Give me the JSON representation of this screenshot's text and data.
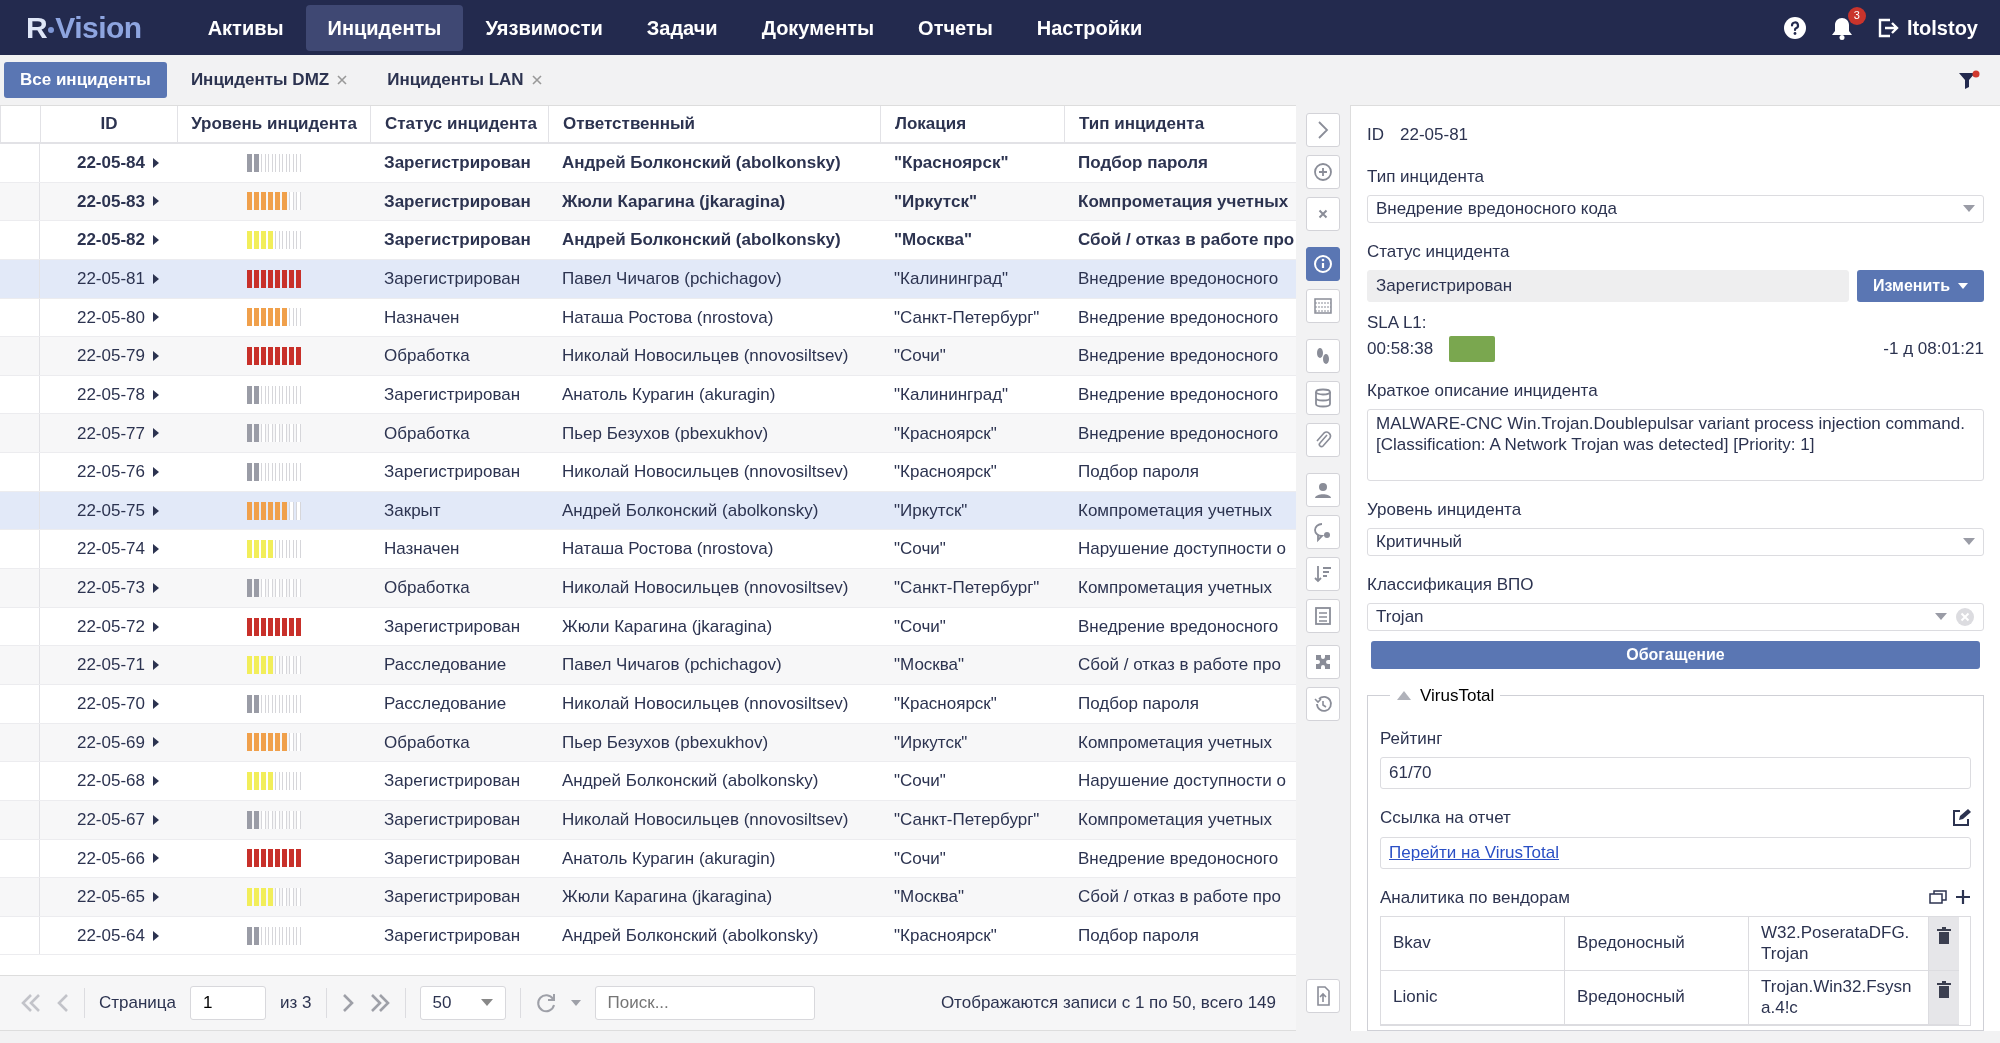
{
  "header": {
    "logo_r": "R",
    "logo_rest": "Vision",
    "nav": [
      {
        "label": "Активы",
        "selected": false
      },
      {
        "label": "Инциденты",
        "selected": true
      },
      {
        "label": "Уязвимости",
        "selected": false
      },
      {
        "label": "Задачи",
        "selected": false
      },
      {
        "label": "Документы",
        "selected": false
      },
      {
        "label": "Отчеты",
        "selected": false
      },
      {
        "label": "Настройки",
        "selected": false
      }
    ],
    "notifications": "3",
    "user": "ltolstoy"
  },
  "filter_tabs": [
    {
      "label": "Все инциденты",
      "selected": true,
      "closable": false
    },
    {
      "label": "Инциденты DMZ",
      "selected": false,
      "closable": true
    },
    {
      "label": "Инциденты LAN",
      "selected": false,
      "closable": true
    }
  ],
  "table": {
    "columns": [
      "ID",
      "Уровень инцидента",
      "Статус инцидента",
      "Ответственный",
      "Локация",
      "Тип инцидента"
    ],
    "rows": [
      {
        "id": "22-05-84",
        "level": 0.25,
        "color": "#9a9ca6",
        "status": "Зарегистрирован",
        "owner": "Андрей Болконский (abolkonsky)",
        "location": "\"Красноярск\"",
        "type": "Подбор пароля",
        "unread": true,
        "selected": false
      },
      {
        "id": "22-05-83",
        "level": 0.75,
        "color": "#f0a04b",
        "status": "Зарегистрирован",
        "owner": "Жюли Карагина (jkaragina)",
        "location": "\"Иркутск\"",
        "type": "Компрометация учетных",
        "unread": true,
        "selected": false
      },
      {
        "id": "22-05-82",
        "level": 0.5,
        "color": "#f2ee5a",
        "status": "Зарегистрирован",
        "owner": "Андрей Болконский (abolkonsky)",
        "location": "\"Москва\"",
        "type": "Сбой / отказ в работе про",
        "unread": true,
        "selected": false
      },
      {
        "id": "22-05-81",
        "level": 1,
        "color": "#c8302a",
        "status": "Зарегистрирован",
        "owner": "Павел Чичагов (pchichagov)",
        "location": "\"Калининград\"",
        "type": "Внедрение вредоносного",
        "unread": false,
        "selected": true
      },
      {
        "id": "22-05-80",
        "level": 0.75,
        "color": "#f0a04b",
        "status": "Назначен",
        "owner": "Наташа Ростова (nrostova)",
        "location": "\"Санкт-Петербург\"",
        "type": "Внедрение вредоносного",
        "unread": false,
        "selected": false
      },
      {
        "id": "22-05-79",
        "level": 1,
        "color": "#c8302a",
        "status": "Обработка",
        "owner": "Николай Новосильцев (nnovosiltsev)",
        "location": "\"Сочи\"",
        "type": "Внедрение вредоносного",
        "unread": false,
        "selected": false
      },
      {
        "id": "22-05-78",
        "level": 0.25,
        "color": "#9a9ca6",
        "status": "Зарегистрирован",
        "owner": "Анатоль Курагин (akuragin)",
        "location": "\"Калининград\"",
        "type": "Внедрение вредоносного",
        "unread": false,
        "selected": false
      },
      {
        "id": "22-05-77",
        "level": 0.25,
        "color": "#9a9ca6",
        "status": "Обработка",
        "owner": "Пьер Безухов (pbexukhov)",
        "location": "\"Красноярск\"",
        "type": "Внедрение вредоносного",
        "unread": false,
        "selected": false
      },
      {
        "id": "22-05-76",
        "level": 0.25,
        "color": "#9a9ca6",
        "status": "Зарегистрирован",
        "owner": "Николай Новосильцев (nnovosiltsev)",
        "location": "\"Красноярск\"",
        "type": "Подбор пароля",
        "unread": false,
        "selected": false
      },
      {
        "id": "22-05-75",
        "level": 0.75,
        "color": "#f0a04b",
        "status": "Закрыт",
        "owner": "Андрей Болконский (abolkonsky)",
        "location": "\"Иркутск\"",
        "type": "Компрометация учетных",
        "unread": false,
        "selected": true
      },
      {
        "id": "22-05-74",
        "level": 0.5,
        "color": "#f2ee5a",
        "status": "Назначен",
        "owner": "Наташа Ростова (nrostova)",
        "location": "\"Сочи\"",
        "type": "Нарушение доступности о",
        "unread": false,
        "selected": false
      },
      {
        "id": "22-05-73",
        "level": 0.25,
        "color": "#9a9ca6",
        "status": "Обработка",
        "owner": "Николай Новосильцев (nnovosiltsev)",
        "location": "\"Санкт-Петербург\"",
        "type": "Компрометация учетных",
        "unread": false,
        "selected": false
      },
      {
        "id": "22-05-72",
        "level": 1,
        "color": "#c8302a",
        "status": "Зарегистрирован",
        "owner": "Жюли Карагина (jkaragina)",
        "location": "\"Сочи\"",
        "type": "Внедрение вредоносного",
        "unread": false,
        "selected": false
      },
      {
        "id": "22-05-71",
        "level": 0.5,
        "color": "#f2ee5a",
        "status": "Расследование",
        "owner": "Павел Чичагов (pchichagov)",
        "location": "\"Москва\"",
        "type": "Сбой / отказ в работе про",
        "unread": false,
        "selected": false
      },
      {
        "id": "22-05-70",
        "level": 0.25,
        "color": "#9a9ca6",
        "status": "Расследование",
        "owner": "Николай Новосильцев (nnovosiltsev)",
        "location": "\"Красноярск\"",
        "type": "Подбор пароля",
        "unread": false,
        "selected": false
      },
      {
        "id": "22-05-69",
        "level": 0.75,
        "color": "#f0a04b",
        "status": "Обработка",
        "owner": "Пьер Безухов (pbexukhov)",
        "location": "\"Иркутск\"",
        "type": "Компрометация учетных",
        "unread": false,
        "selected": false
      },
      {
        "id": "22-05-68",
        "level": 0.5,
        "color": "#f2ee5a",
        "status": "Зарегистрирован",
        "owner": "Андрей Болконский (abolkonsky)",
        "location": "\"Сочи\"",
        "type": "Нарушение доступности о",
        "unread": false,
        "selected": false
      },
      {
        "id": "22-05-67",
        "level": 0.25,
        "color": "#9a9ca6",
        "status": "Зарегистрирован",
        "owner": "Николай Новосильцев (nnovosiltsev)",
        "location": "\"Санкт-Петербург\"",
        "type": "Компрометация учетных",
        "unread": false,
        "selected": false
      },
      {
        "id": "22-05-66",
        "level": 1,
        "color": "#c8302a",
        "status": "Зарегистрирован",
        "owner": "Анатоль Курагин (akuragin)",
        "location": "\"Сочи\"",
        "type": "Внедрение вредоносного",
        "unread": false,
        "selected": false
      },
      {
        "id": "22-05-65",
        "level": 0.5,
        "color": "#f2ee5a",
        "status": "Зарегистрирован",
        "owner": "Жюли Карагина (jkaragina)",
        "location": "\"Москва\"",
        "type": "Сбой / отказ в работе про",
        "unread": false,
        "selected": false
      },
      {
        "id": "22-05-64",
        "level": 0.25,
        "color": "#9a9ca6",
        "status": "Зарегистрирован",
        "owner": "Андрей Болконский (abolkonsky)",
        "location": "\"Красноярск\"",
        "type": "Подбор пароля",
        "unread": false,
        "selected": false
      }
    ]
  },
  "pager": {
    "page_label": "Страница",
    "page": "1",
    "of": "из 3",
    "page_size": "50",
    "search_placeholder": "Поиск...",
    "summary": "Отображаются записи с 1 по 50, всего 149"
  },
  "side_toolbar": [
    {
      "kind": "collapse",
      "selected": false
    },
    {
      "kind": "add",
      "selected": false
    },
    {
      "kind": "close",
      "selected": false
    },
    {
      "kind": "info",
      "selected": true
    },
    {
      "kind": "grid",
      "selected": false
    },
    {
      "kind": "steps",
      "selected": false
    },
    {
      "kind": "database",
      "selected": false
    },
    {
      "kind": "attach",
      "selected": false
    },
    {
      "kind": "user",
      "selected": false
    },
    {
      "kind": "comment",
      "selected": false
    },
    {
      "kind": "sort",
      "selected": false
    },
    {
      "kind": "list",
      "selected": false
    },
    {
      "kind": "puzzle",
      "selected": false
    },
    {
      "kind": "history",
      "selected": false
    },
    {
      "kind": "export",
      "selected": false
    }
  ],
  "details": {
    "id_label": "ID",
    "id": "22-05-81",
    "type_label": "Тип инцидента",
    "type": "Внедрение вредоносного кода",
    "status_label": "Статус инцидента",
    "status": "Зарегистрирован",
    "change_button": "Изменить",
    "sla_label": "SLA L1:",
    "sla_time": "00:58:38",
    "sla_remaining": "-1 д 08:01:21",
    "description_label": "Краткое описание инцидента",
    "description": "MALWARE-CNC Win.Trojan.Doublepulsar variant process injection command. [Classification: A Network Trojan was detected] [Priority: 1]",
    "level_label": "Уровень инцидента",
    "level": "Критичный",
    "malware_label": "Классификация ВПО",
    "malware": "Trojan",
    "enrich_button": "Обогащение",
    "virustotal": {
      "title": "VirusTotal",
      "expanded": true,
      "rating_label": "Рейтинг",
      "rating": "61/70",
      "link_label": "Ссылка на отчет",
      "link": "Перейти на VirusTotal",
      "vendors_label": "Аналитика по вендорам",
      "vendors": [
        {
          "vendor": "Bkav",
          "verdict": "Вредоносный",
          "result": "W32.PoserataDFG. Trojan"
        },
        {
          "vendor": "Lionic",
          "verdict": "Вредоносный",
          "result": "Trojan.Win32.Fsysna.4!c"
        }
      ]
    }
  }
}
